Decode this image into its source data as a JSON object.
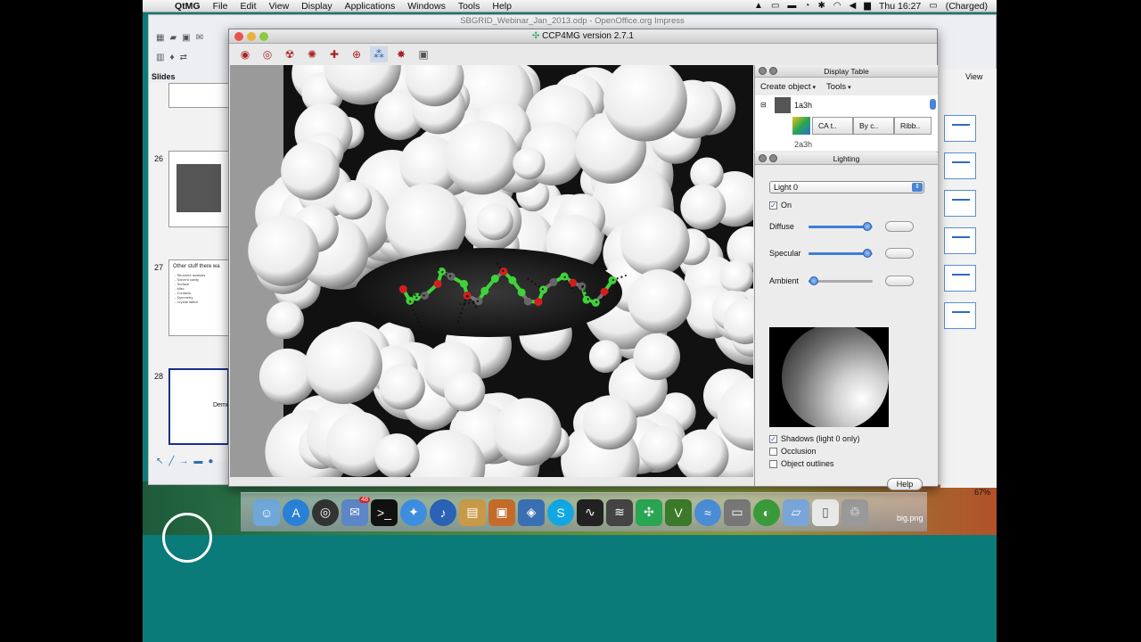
{
  "menubar": {
    "app_name": "QtMG",
    "items": [
      "File",
      "Edit",
      "View",
      "Display",
      "Applications",
      "Windows",
      "Tools",
      "Help"
    ],
    "clock": "Thu 16:27",
    "battery": "(Charged)"
  },
  "impress": {
    "title": "SBGRID_Webinar_Jan_2013.odp - OpenOffice.org Impress",
    "slides_label": "Slides",
    "view_label": "View",
    "zoom": "67%",
    "slides": [
      {
        "num": "26",
        "text": ""
      },
      {
        "num": "27",
        "text": "Other stuff there wa"
      },
      {
        "num": "28",
        "text": "Demo"
      }
    ],
    "slide27_lines": [
      "- Structure analysis",
      "- Solvent cavity",
      "- Surface",
      "- Misc",
      "- Contacts",
      "- Symmetry",
      "- Crystal lattice"
    ]
  },
  "ccp4mg": {
    "title": "CCP4MG version 2.7.1"
  },
  "display_table": {
    "title": "Display Table",
    "menu": [
      "Create object",
      "Tools"
    ],
    "objects": [
      {
        "name": "1a3h",
        "buttons": [
          "CA t..",
          "By c..",
          "Ribb.."
        ]
      },
      {
        "name": "2a3h"
      }
    ]
  },
  "lighting": {
    "title": "Lighting",
    "light_select": "Light 0",
    "on_label": "On",
    "sliders": [
      {
        "label": "Diffuse",
        "value": 0.92
      },
      {
        "label": "Specular",
        "value": 0.92
      },
      {
        "label": "Ambient",
        "value": 0.08
      }
    ],
    "options": [
      {
        "label": "Shadows (light 0 only)",
        "checked": true
      },
      {
        "label": "Occlusion",
        "checked": false
      },
      {
        "label": "Object outlines",
        "checked": false
      }
    ],
    "help_label": "Help"
  },
  "dock": {
    "mail_badge": "48",
    "file_label": "big.png"
  },
  "colors": {
    "teal_bg": "#0b7b7a",
    "accent_blue": "#3e7fd6",
    "ligand_green": "#3fd23a",
    "oxygen_red": "#d41e1e"
  }
}
